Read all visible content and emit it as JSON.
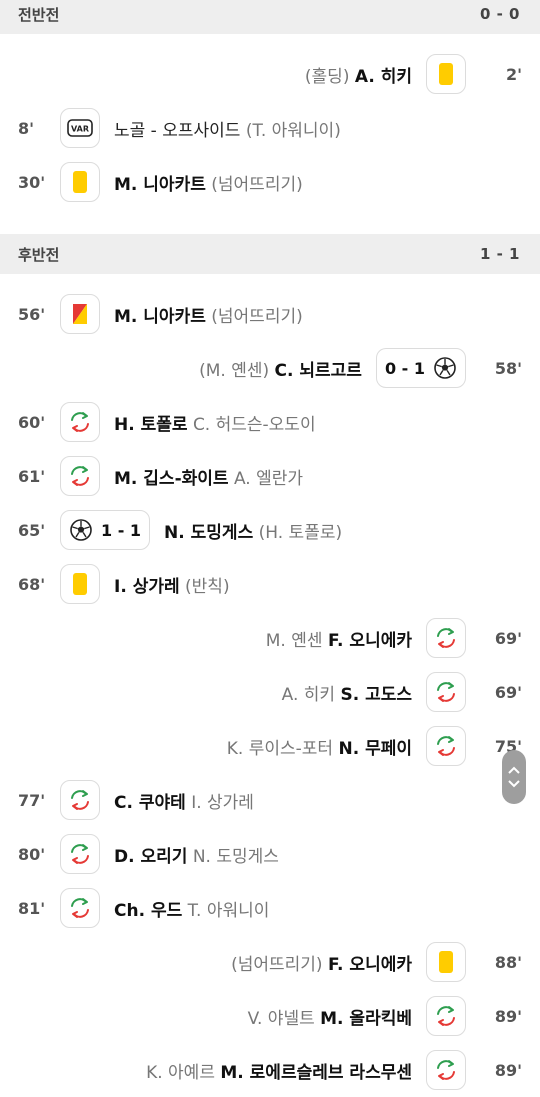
{
  "first_half": {
    "label": "전반전",
    "score": "0 - 0"
  },
  "second_half": {
    "label": "후반전",
    "score": "1 - 1"
  },
  "events": {
    "e1": {
      "minute": "2'",
      "player": "A. 히키",
      "reason": "(홀딩)"
    },
    "e2": {
      "minute": "8'",
      "text": "노골 - 오프사이드",
      "secondary": "(T. 아워니이)"
    },
    "e3": {
      "minute": "30'",
      "player": "M. 니아카트",
      "reason": "(넘어뜨리기)"
    },
    "e4": {
      "minute": "56'",
      "player": "M. 니아카트",
      "reason": "(넘어뜨리기)"
    },
    "e5": {
      "minute": "58'",
      "player": "C. 뇌르고르",
      "assist": "(M. 옌센)",
      "score": "0 - 1"
    },
    "e6": {
      "minute": "60'",
      "player_in": "H. 토폴로",
      "player_out": "C. 허드슨-오도이"
    },
    "e7": {
      "minute": "61'",
      "player_in": "M. 깁스-화이트",
      "player_out": "A. 엘란가"
    },
    "e8": {
      "minute": "65'",
      "player": "N. 도밍게스",
      "assist": "(H. 토폴로)",
      "score": "1 - 1"
    },
    "e9": {
      "minute": "68'",
      "player": "I. 상가레",
      "reason": "(반칙)"
    },
    "e10": {
      "minute": "69'",
      "player_in": "F. 오니에카",
      "player_out": "M. 옌센"
    },
    "e11": {
      "minute": "69'",
      "player_in": "S. 고도스",
      "player_out": "A. 히키"
    },
    "e12": {
      "minute": "75'",
      "player_in": "N. 무페이",
      "player_out": "K. 루이스-포터"
    },
    "e13": {
      "minute": "77'",
      "player_in": "C. 쿠야테",
      "player_out": "I. 상가레"
    },
    "e14": {
      "minute": "80'",
      "player_in": "D. 오리기",
      "player_out": "N. 도밍게스"
    },
    "e15": {
      "minute": "81'",
      "player_in": "Ch. 우드",
      "player_out": "T. 아워니이"
    },
    "e16": {
      "minute": "88'",
      "player": "F. 오니에카",
      "reason": "(넘어뜨리기)"
    },
    "e17": {
      "minute": "89'",
      "player_in": "M. 올라킥베",
      "player_out": "V. 야넬트"
    },
    "e18": {
      "minute": "89'",
      "player_in": "M. 로에르슬레브 라스무센",
      "player_out": "K. 아예르"
    }
  },
  "colors": {
    "yellow_card": "#ffcc00",
    "red_card": "#e53935",
    "sub_in": "#2e9e4f",
    "sub_out": "#e53935"
  }
}
